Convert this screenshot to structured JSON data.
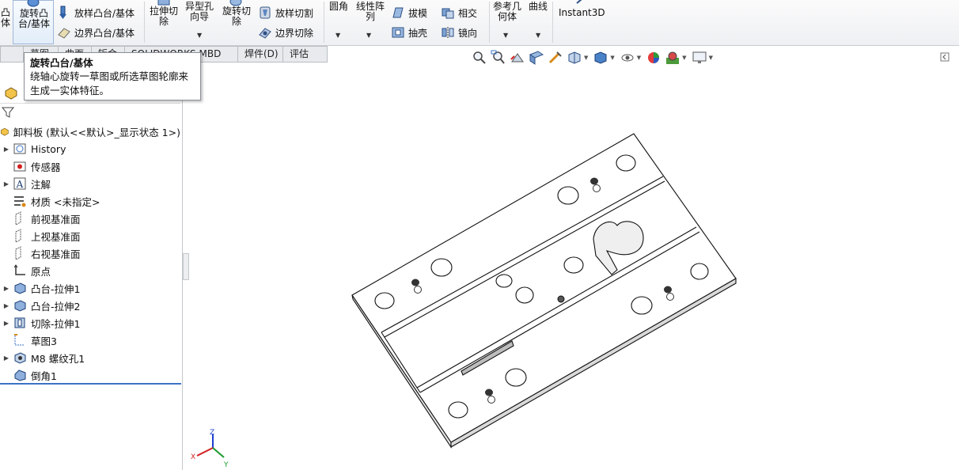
{
  "ribbon": {
    "partial_left_line1": "凸",
    "partial_left_line2": "体",
    "revolve_boss_line1": "旋转凸",
    "revolve_boss_line2": "台/基体",
    "sweep_boss": "放样凸台/基体",
    "boundary_boss": "边界凸台/基体",
    "extrude_cut_line1": "拉伸切",
    "extrude_cut_line2": "除",
    "hole_wizard_line1": "异型孔",
    "hole_wizard_line2": "向导",
    "revolve_cut_line1": "旋转切",
    "revolve_cut_line2": "除",
    "loft_cut": "放样切割",
    "boundary_cut": "边界切除",
    "fillet": "圆角",
    "linear_pattern_line1": "线性阵",
    "linear_pattern_line2": "列",
    "draft": "拔模",
    "shell": "抽壳",
    "intersect": "相交",
    "mirror": "镜向",
    "ref_geom_line1": "参考几",
    "ref_geom_line2": "何体",
    "curves": "曲线",
    "instant3d": "Instant3D"
  },
  "tabs": [
    {
      "label": "草图"
    },
    {
      "label": "曲面"
    },
    {
      "label": "钣金"
    },
    {
      "label": "SOLIDWORKS MBD"
    },
    {
      "label": "焊件(D)"
    },
    {
      "label": "评估"
    }
  ],
  "tooltip": {
    "title": "旋转凸台/基体",
    "body_line1": "绕轴心旋转一草图或所选草图轮廓来",
    "body_line2": "生成一实体特征。"
  },
  "tree": {
    "root": "卸料板  (默认<<默认>_显示状态 1>)",
    "items": [
      {
        "label": "History"
      },
      {
        "label": "传感器"
      },
      {
        "label": "注解"
      },
      {
        "label": "材质 <未指定>"
      },
      {
        "label": "前视基准面"
      },
      {
        "label": "上视基准面"
      },
      {
        "label": "右视基准面"
      },
      {
        "label": "原点"
      },
      {
        "label": "凸台-拉伸1"
      },
      {
        "label": "凸台-拉伸2"
      },
      {
        "label": "切除-拉伸1"
      },
      {
        "label": "草图3"
      },
      {
        "label": "M8 螺纹孔1"
      },
      {
        "label": "倒角1"
      }
    ]
  },
  "triad": {
    "x": "X",
    "y": "Y",
    "z": "Z"
  },
  "colors": {
    "accent": "#3b73c4",
    "triad_x": "#d42020",
    "triad_y": "#1a9a2a",
    "triad_z": "#1f3fd1"
  }
}
